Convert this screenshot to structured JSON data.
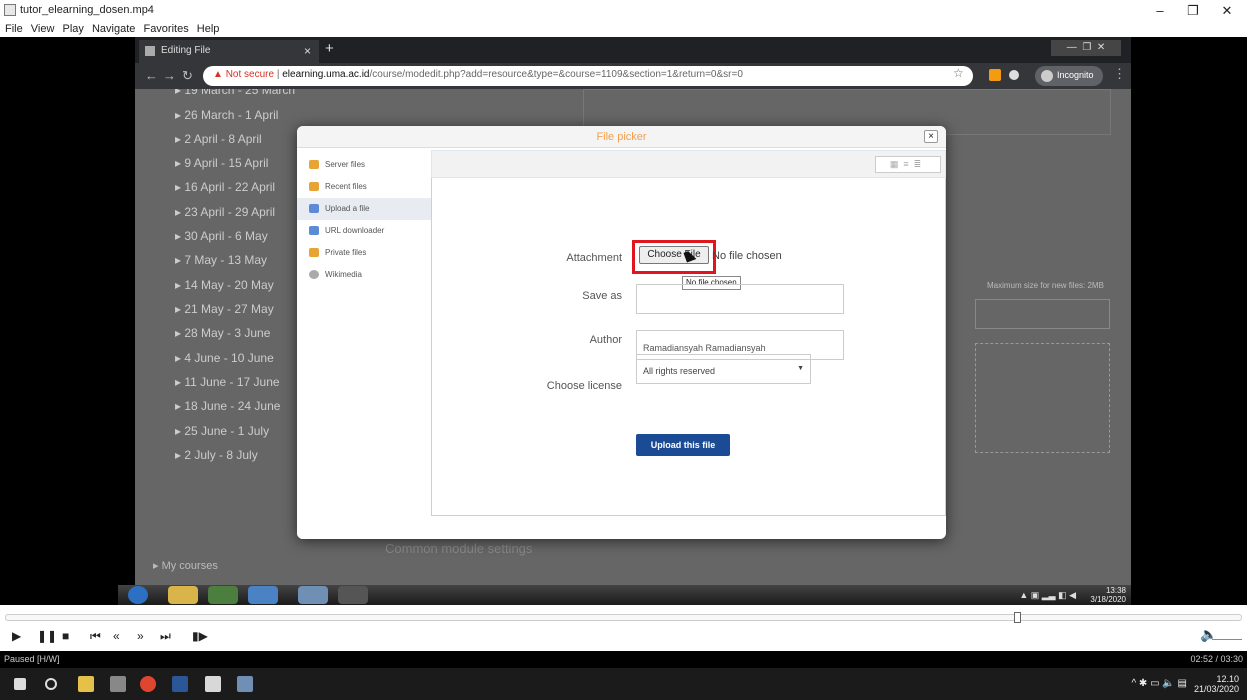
{
  "window": {
    "title": "tutor_elearning_dosen.mp4"
  },
  "menu": [
    "File",
    "View",
    "Play",
    "Navigate",
    "Favorites",
    "Help"
  ],
  "browser": {
    "tab_title": "Editing File",
    "not_secure": "Not secure",
    "url_domain": "elearning.uma.ac.id",
    "url_path": "/course/modedit.php?add=resource&type=&course=1109&section=1&return=0&sr=0",
    "incognito": "Incognito"
  },
  "course": {
    "weeks": [
      "19 March - 25 March",
      "26 March - 1 April",
      "2 April - 8 April",
      "9 April - 15 April",
      "16 April - 22 April",
      "23 April - 29 April",
      "30 April - 6 May",
      "7 May - 13 May",
      "14 May - 20 May",
      "21 May - 27 May",
      "28 May - 3 June",
      "4 June - 10 June",
      "11 June - 17 June",
      "18 June - 24 June",
      "25 June - 1 July",
      "2 July - 8 July"
    ],
    "my_courses": "My courses",
    "max_size": "Maximum size for new files: 2MB",
    "common_settings": "Common module settings"
  },
  "picker": {
    "title": "File picker",
    "repos": [
      "Server files",
      "Recent files",
      "Upload a file",
      "URL downloader",
      "Private files",
      "Wikimedia"
    ],
    "attachment_label": "Attachment",
    "choose_file": "Choose File",
    "no_file": "No file chosen",
    "tooltip": "No file chosen",
    "save_as_label": "Save as",
    "author_label": "Author",
    "author_value": "Ramadiansyah Ramadiansyah",
    "license_label": "Choose license",
    "license_value": "All rights reserved",
    "upload_button": "Upload this file"
  },
  "guest_clock": {
    "time": "13:38",
    "date": "3/18/2020"
  },
  "player": {
    "status": "Paused [H/W]",
    "time": "02:52 / 03:30"
  },
  "host_clock": {
    "time": "12.10",
    "date": "21/03/2020"
  },
  "colors": {
    "highlight": "#e0161e",
    "upload": "#1a4b94",
    "picker_title": "#f0a050"
  }
}
